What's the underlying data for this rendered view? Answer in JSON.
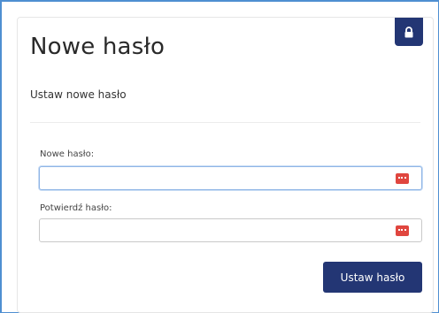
{
  "form": {
    "title": "Nowe hasło",
    "subtitle": "Ustaw nowe hasło",
    "new_password_label": "Nowe hasło:",
    "new_password_value": "",
    "confirm_password_label": "Potwierdź hasło:",
    "confirm_password_value": "",
    "submit_label": "Ustaw hasło"
  },
  "icons": {
    "badge": "lock-icon",
    "field_addon": "password-manager-icon"
  },
  "colors": {
    "primary": "#233674",
    "password_manager_icon": "#e0463f",
    "focus_border": "#8fb5e6"
  }
}
